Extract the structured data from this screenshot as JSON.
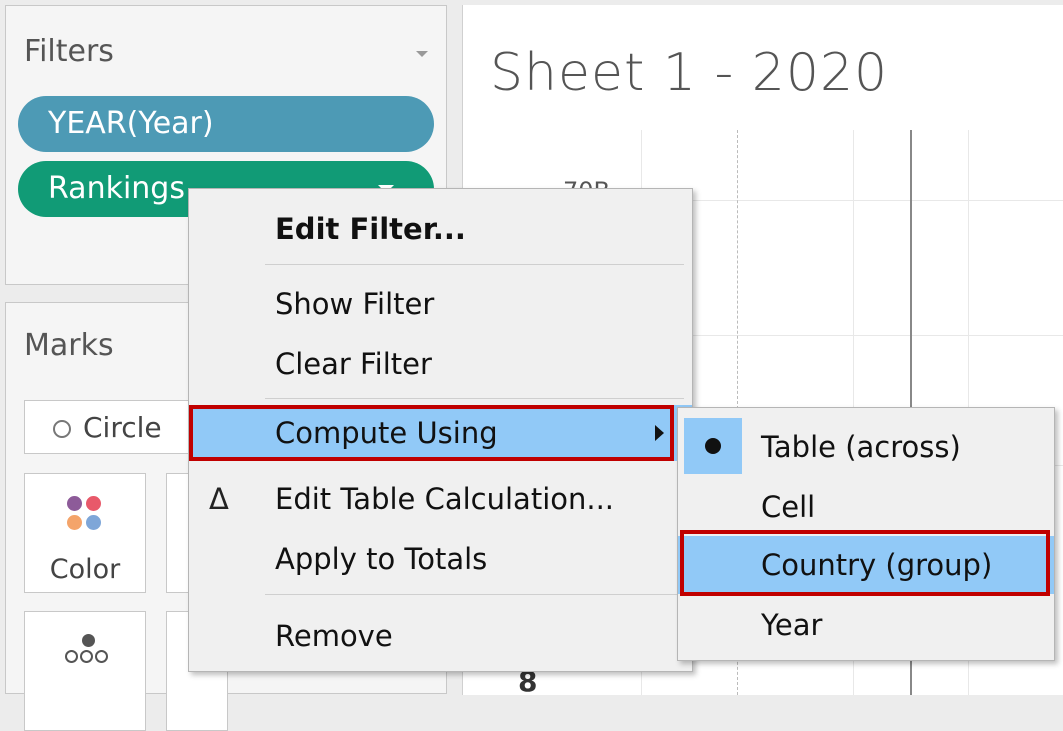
{
  "filters": {
    "title": "Filters",
    "pills": [
      "YEAR(Year)",
      "Rankings"
    ]
  },
  "marks": {
    "title": "Marks",
    "type": "Circle",
    "color_label": "Color",
    "color_dots": [
      "#8d5b99",
      "#e8596a",
      "#f4a46a",
      "#7ea6d8"
    ]
  },
  "sheet": {
    "title": "Sheet 1 - 2020",
    "axis_tick_top": "70B",
    "axis_tick_bottom": "8"
  },
  "context_menu": {
    "items": [
      "Edit Filter...",
      "Show Filter",
      "Clear Filter",
      "Compute Using",
      "Edit Table Calculation...",
      "Apply to Totals",
      "Remove"
    ],
    "delta_icon": "Δ"
  },
  "compute_submenu": {
    "items": [
      "Table (across)",
      "Cell",
      "Country (group)",
      "Year"
    ],
    "selected": "Table (across)",
    "highlighted": "Country (group)"
  },
  "colors": {
    "year_pill": "#4d9ab5",
    "rankings_pill": "#119b76",
    "menu_highlight": "#91c9f7",
    "annotation_outline": "#c00000"
  }
}
